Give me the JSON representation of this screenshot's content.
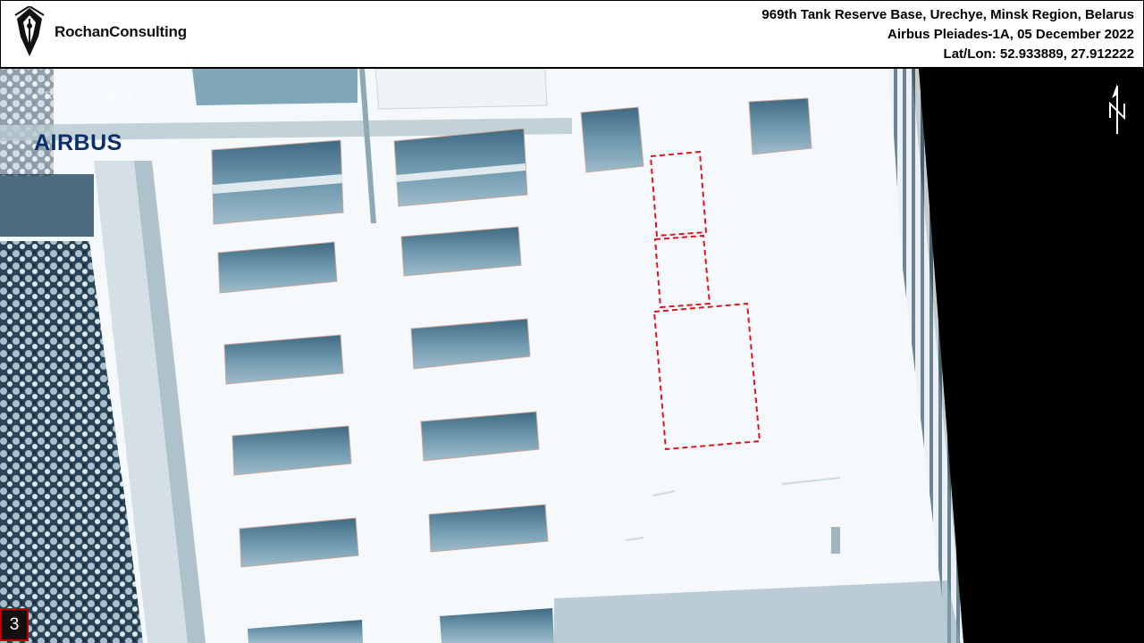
{
  "brand": {
    "logo_text": "RochanConsulting",
    "watermark_text": "RochanConsulting",
    "imagery_provider_logo": "AIRBUS"
  },
  "caption": {
    "line1": "969th Tank Reserve Base, Urechye, Minsk Region, Belarus",
    "line2": "Airbus Pleiades-1A, 05 December 2022",
    "line3": "Lat/Lon:  52.933889, 27.912222"
  },
  "slide_number": "3",
  "colors": {
    "annotation_dash": "#e0141e",
    "airbus_blue": "#0b2f6b",
    "slide_number_border": "#c00000"
  },
  "icons": {
    "north": "north-arrow-icon",
    "logo": "pen-nib-logo-icon"
  }
}
